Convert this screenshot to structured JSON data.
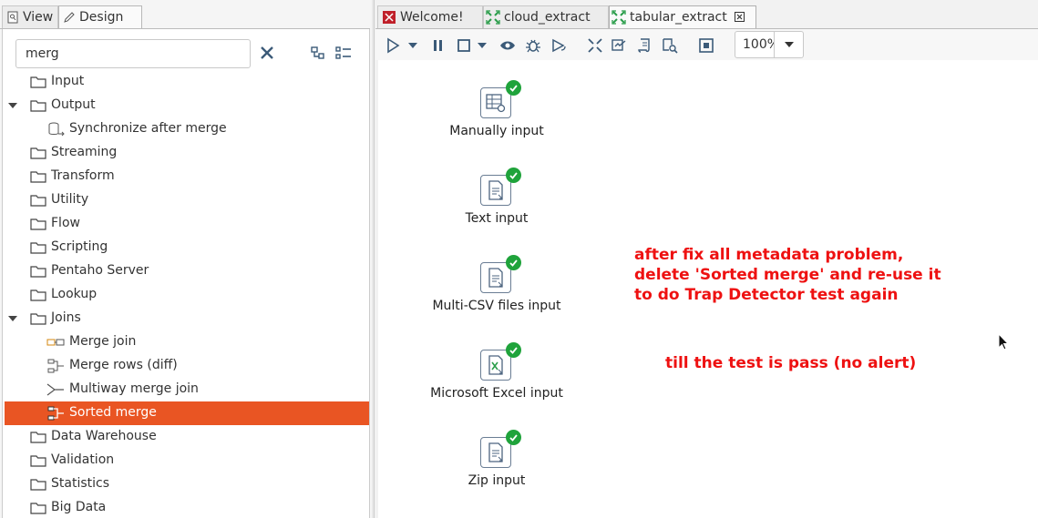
{
  "left_panel": {
    "tabs": [
      {
        "label": "View",
        "icon": "view-icon"
      },
      {
        "label": "Design",
        "icon": "pencil-icon"
      }
    ],
    "search": {
      "value": "merg"
    },
    "tree": [
      {
        "label": "Input",
        "type": "folder",
        "expanded": false
      },
      {
        "label": "Output",
        "type": "folder",
        "expanded": true
      },
      {
        "label": "Synchronize after merge",
        "type": "step",
        "icon": "database-sync-icon"
      },
      {
        "label": "Streaming",
        "type": "folder",
        "expanded": false
      },
      {
        "label": "Transform",
        "type": "folder",
        "expanded": false
      },
      {
        "label": "Utility",
        "type": "folder",
        "expanded": false
      },
      {
        "label": "Flow",
        "type": "folder",
        "expanded": false
      },
      {
        "label": "Scripting",
        "type": "folder",
        "expanded": false
      },
      {
        "label": "Pentaho Server",
        "type": "folder",
        "expanded": false
      },
      {
        "label": "Lookup",
        "type": "folder",
        "expanded": false
      },
      {
        "label": "Joins",
        "type": "folder",
        "expanded": true
      },
      {
        "label": "Merge join",
        "type": "step",
        "icon": "merge-join-icon"
      },
      {
        "label": "Merge rows (diff)",
        "type": "step",
        "icon": "merge-rows-icon"
      },
      {
        "label": "Multiway merge join",
        "type": "step",
        "icon": "multiway-merge-icon"
      },
      {
        "label": "Sorted merge",
        "type": "step",
        "icon": "sorted-merge-icon",
        "selected": true
      },
      {
        "label": "Data Warehouse",
        "type": "folder",
        "expanded": false
      },
      {
        "label": "Validation",
        "type": "folder",
        "expanded": false
      },
      {
        "label": "Statistics",
        "type": "folder",
        "expanded": false
      },
      {
        "label": "Big Data",
        "type": "folder",
        "expanded": false
      }
    ]
  },
  "editor": {
    "tabs": [
      {
        "label": "Welcome!",
        "icon": "pentaho-logo-icon"
      },
      {
        "label": "cloud_extract",
        "icon": "transformation-icon"
      },
      {
        "label": "tabular_extract",
        "icon": "transformation-icon",
        "active": true
      }
    ],
    "zoom": "100%",
    "steps": [
      {
        "label": "Manually input",
        "icon": "table-gear-icon"
      },
      {
        "label": "Text input",
        "icon": "text-file-icon"
      },
      {
        "label": "Multi-CSV files input",
        "icon": "text-file-icon"
      },
      {
        "label": "Microsoft Excel input",
        "icon": "excel-file-icon"
      },
      {
        "label": "Zip input",
        "icon": "text-file-icon"
      }
    ],
    "notes": [
      "after fix all metadata problem,",
      "delete 'Sorted merge' and re-use it",
      "to do Trap Detector test again",
      "till the test is pass (no alert)"
    ]
  },
  "colors": {
    "selection": "#e95523",
    "note": "#ee1111",
    "check": "#1fa33b"
  }
}
